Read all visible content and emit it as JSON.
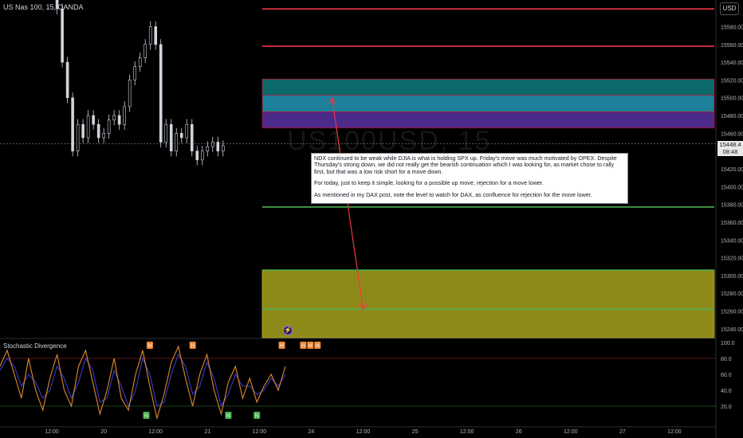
{
  "header": {
    "symbol_line": "US Nas 100, 15, OANDA",
    "currency_button": "USD"
  },
  "watermark": "US100USD, 15",
  "annotation": {
    "paragraph1": "NDX continued to be weak while DJIA is what is holding SPX up. Friday's move was much motivated by OPEX. Despite Thursday's strong down, we did not really get the bearish continuation which I was looking for, as market chose to rally first, but that was a low risk short for a move down.",
    "paragraph2": "For today, just to keep it simple, looking for a possible up move, rejection for a move lower.",
    "paragraph3": "As mentioned in my DAX post, note the level to watch for DAX, as confluence for rejection for the move lower."
  },
  "price_badge": {
    "price": "15448.4",
    "countdown": "08:48"
  },
  "indicator": {
    "title": "Stochastic Divergence",
    "axis_labels": [
      "100.0",
      "80.0",
      "60.0",
      "40.0",
      "20.0"
    ],
    "axis_values": [
      100,
      80,
      60,
      40,
      20
    ],
    "signals": [
      {
        "type": "H",
        "x": 19.3
      },
      {
        "type": "H",
        "x": 19.9
      },
      {
        "type": "N",
        "x": 19.25
      },
      {
        "type": "N",
        "x": 20.4
      },
      {
        "type": "N",
        "x": 20.8
      },
      {
        "type": "H",
        "x": 21.15
      },
      {
        "type": "H",
        "x": 21.45
      },
      {
        "type": "H",
        "x": 21.55
      },
      {
        "type": "H",
        "x": 21.65
      }
    ]
  },
  "colors": {
    "background": "#000000",
    "resistance": "#f23645",
    "support": "#4caf50",
    "zone_cyan": "#1e7f9a",
    "zone_purple": "#4b2a8a",
    "zone_teal": "#0d6a6a",
    "zone_olive": "#8e8a1a",
    "candle": "#d1d4dc",
    "stoch_k": "#e08a2e",
    "stoch_d": "#3b3bcc"
  },
  "chart_data": {
    "type": "candlestick",
    "title": "US Nas 100, 15, OANDA",
    "ylim": [
      15230,
      15610
    ],
    "y_ticks": [
      15580,
      15560,
      15540,
      15520,
      15500,
      15480,
      15460,
      15440,
      15420,
      15400,
      15380,
      15360,
      15340,
      15320,
      15300,
      15280,
      15260,
      15240
    ],
    "x_ticks": [
      {
        "label": "12:00",
        "x": 18.5
      },
      {
        "label": "20",
        "x": 19.0
      },
      {
        "label": "12:00",
        "x": 19.5
      },
      {
        "label": "21",
        "x": 20.0
      },
      {
        "label": "12:00",
        "x": 20.5
      },
      {
        "label": "24",
        "x": 21.0
      },
      {
        "label": "12:00",
        "x": 21.5
      },
      {
        "label": "25",
        "x": 22.0
      },
      {
        "label": "12:00",
        "x": 22.5
      },
      {
        "label": "26",
        "x": 23.0
      },
      {
        "label": "12:00",
        "x": 23.5
      },
      {
        "label": "27",
        "x": 24.0
      },
      {
        "label": "12:00",
        "x": 24.5
      }
    ],
    "last_price": 15448.4,
    "levels": [
      {
        "kind": "resistance",
        "price": 15600
      },
      {
        "kind": "resistance",
        "price": 15558
      },
      {
        "kind": "support",
        "price": 15377
      },
      {
        "kind": "support",
        "price": 15306
      },
      {
        "kind": "support",
        "price": 15262
      }
    ],
    "zones": [
      {
        "kind": "teal",
        "from": 15503,
        "to": 15521
      },
      {
        "kind": "cyan",
        "from": 15484,
        "to": 15503
      },
      {
        "kind": "purple",
        "from": 15466,
        "to": 15484
      },
      {
        "kind": "olive",
        "from": 15230,
        "to": 15306
      }
    ],
    "projection": [
      {
        "x": 21.2,
        "price": 15500
      },
      {
        "x": 21.5,
        "price": 15262
      }
    ],
    "price_series": [
      [
        18.5,
        15610
      ],
      [
        18.55,
        15600
      ],
      [
        18.6,
        15540
      ],
      [
        18.65,
        15500
      ],
      [
        18.7,
        15440
      ],
      [
        18.75,
        15470
      ],
      [
        18.8,
        15455
      ],
      [
        18.85,
        15480
      ],
      [
        18.9,
        15470
      ],
      [
        18.95,
        15455
      ],
      [
        19.0,
        15460
      ],
      [
        19.05,
        15475
      ],
      [
        19.1,
        15480
      ],
      [
        19.15,
        15470
      ],
      [
        19.2,
        15490
      ],
      [
        19.25,
        15520
      ],
      [
        19.3,
        15535
      ],
      [
        19.35,
        15545
      ],
      [
        19.4,
        15560
      ],
      [
        19.45,
        15580
      ],
      [
        19.5,
        15560
      ],
      [
        19.55,
        15450
      ],
      [
        19.6,
        15470
      ],
      [
        19.65,
        15440
      ],
      [
        19.7,
        15460
      ],
      [
        19.75,
        15455
      ],
      [
        19.8,
        15470
      ],
      [
        19.85,
        15440
      ],
      [
        19.9,
        15430
      ],
      [
        19.95,
        15440
      ],
      [
        20.0,
        15445
      ],
      [
        20.05,
        15450
      ],
      [
        20.1,
        15440
      ],
      [
        20.15,
        15446
      ]
    ],
    "stochastic": {
      "k": [
        [
          17.2,
          70
        ],
        [
          17.3,
          90
        ],
        [
          17.4,
          60
        ],
        [
          17.5,
          30
        ],
        [
          17.6,
          80
        ],
        [
          17.7,
          40
        ],
        [
          17.8,
          15
        ],
        [
          17.9,
          55
        ],
        [
          18.0,
          85
        ],
        [
          18.1,
          40
        ],
        [
          18.2,
          20
        ],
        [
          18.3,
          70
        ],
        [
          18.4,
          90
        ],
        [
          18.5,
          50
        ],
        [
          18.6,
          10
        ],
        [
          18.7,
          40
        ],
        [
          18.8,
          80
        ],
        [
          18.9,
          30
        ],
        [
          19.0,
          15
        ],
        [
          19.1,
          60
        ],
        [
          19.2,
          90
        ],
        [
          19.3,
          45
        ],
        [
          19.4,
          5
        ],
        [
          19.5,
          35
        ],
        [
          19.6,
          75
        ],
        [
          19.7,
          95
        ],
        [
          19.8,
          55
        ],
        [
          19.9,
          20
        ],
        [
          20.0,
          60
        ],
        [
          20.1,
          85
        ],
        [
          20.2,
          40
        ],
        [
          20.3,
          10
        ],
        [
          20.4,
          50
        ],
        [
          20.5,
          70
        ],
        [
          20.6,
          30
        ],
        [
          20.7,
          55
        ],
        [
          20.8,
          25
        ],
        [
          20.9,
          45
        ],
        [
          21.0,
          60
        ],
        [
          21.1,
          40
        ],
        [
          21.2,
          70
        ]
      ],
      "d": [
        [
          17.2,
          65
        ],
        [
          17.3,
          80
        ],
        [
          17.4,
          70
        ],
        [
          17.5,
          45
        ],
        [
          17.6,
          60
        ],
        [
          17.7,
          50
        ],
        [
          17.8,
          30
        ],
        [
          17.9,
          40
        ],
        [
          18.0,
          70
        ],
        [
          18.1,
          55
        ],
        [
          18.2,
          30
        ],
        [
          18.3,
          50
        ],
        [
          18.4,
          80
        ],
        [
          18.5,
          65
        ],
        [
          18.6,
          25
        ],
        [
          18.7,
          30
        ],
        [
          18.8,
          65
        ],
        [
          18.9,
          45
        ],
        [
          19.0,
          20
        ],
        [
          19.1,
          40
        ],
        [
          19.2,
          80
        ],
        [
          19.3,
          60
        ],
        [
          19.4,
          20
        ],
        [
          19.5,
          25
        ],
        [
          19.6,
          60
        ],
        [
          19.7,
          85
        ],
        [
          19.8,
          70
        ],
        [
          19.9,
          35
        ],
        [
          20.0,
          45
        ],
        [
          20.1,
          75
        ],
        [
          20.2,
          55
        ],
        [
          20.3,
          20
        ],
        [
          20.4,
          35
        ],
        [
          20.5,
          60
        ],
        [
          20.6,
          45
        ],
        [
          20.7,
          45
        ],
        [
          20.8,
          35
        ],
        [
          20.9,
          40
        ],
        [
          21.0,
          55
        ],
        [
          21.1,
          45
        ],
        [
          21.2,
          60
        ]
      ]
    }
  }
}
